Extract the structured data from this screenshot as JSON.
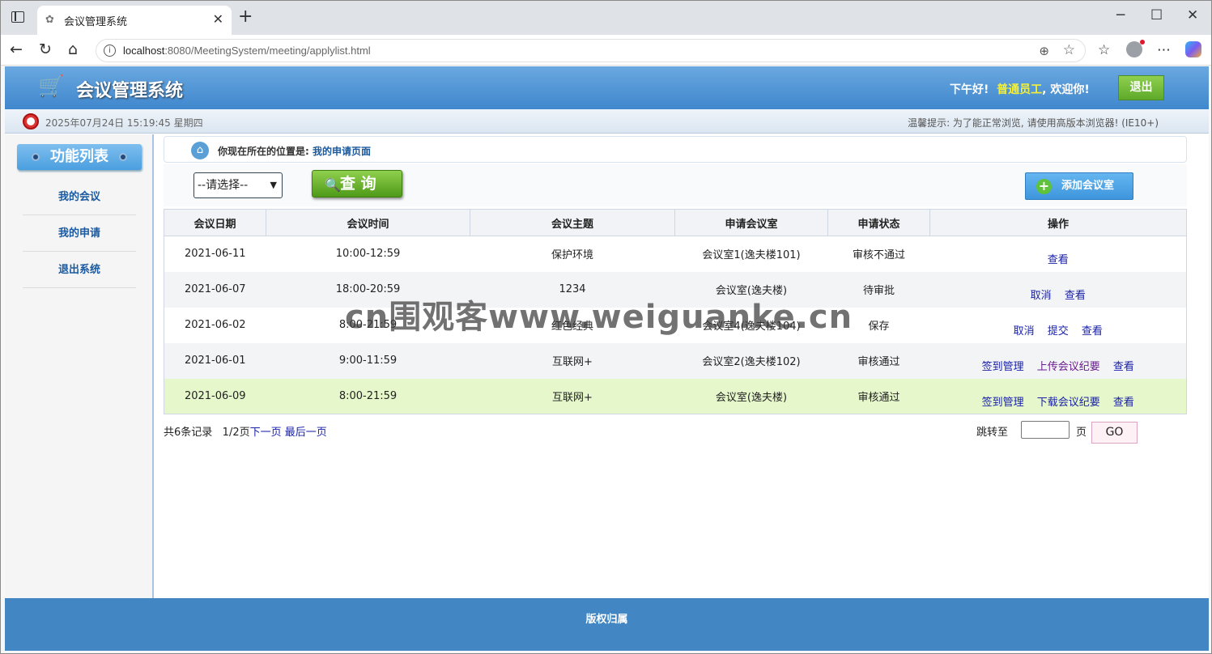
{
  "browser": {
    "tab_title": "会议管理系统",
    "url_host": "localhost",
    "url_rest": ":8080/MeetingSystem/meeting/applylist.html"
  },
  "header": {
    "title": "会议管理系统",
    "greeting": "下午好!",
    "role": "普通员工",
    "welcome": ", 欢迎你!",
    "logout_label": "退出"
  },
  "infobar": {
    "datetime": "2025年07月24日 15:19:45 星期四",
    "tip": "温馨提示: 为了能正常浏览, 请使用高版本浏览器! (IE10+)"
  },
  "sidebar": {
    "title": "功能列表",
    "items": [
      {
        "label": "我的会议"
      },
      {
        "label": "我的申请"
      },
      {
        "label": "退出系统"
      }
    ]
  },
  "breadcrumb": {
    "prefix": "你现在所在的位置是:",
    "current": "我的申请页面"
  },
  "toolbar": {
    "select_value": "--请选择--",
    "query_label": "查 询",
    "add_room_label": "添加会议室"
  },
  "table": {
    "headers": [
      "会议日期",
      "会议时间",
      "会议主题",
      "申请会议室",
      "申请状态",
      "操作"
    ],
    "rows": [
      {
        "date": "2021-06-11",
        "time": "10:00-12:59",
        "topic": "保护环境",
        "room": "会议室1(逸夫楼101)",
        "status": "审核不通过",
        "ops": [
          "查看"
        ]
      },
      {
        "date": "2021-06-07",
        "time": "18:00-20:59",
        "topic": "1234",
        "room": "会议室(逸夫楼)",
        "status": "待审批",
        "ops": [
          "取消",
          "查看"
        ]
      },
      {
        "date": "2021-06-02",
        "time": "8:00-21:59",
        "topic": "红色经典",
        "room": "会议室4(逸夫楼104)",
        "status": "保存",
        "ops": [
          "取消",
          "提交",
          "查看"
        ]
      },
      {
        "date": "2021-06-01",
        "time": "9:00-11:59",
        "topic": "互联网+",
        "room": "会议室2(逸夫楼102)",
        "status": "审核通过",
        "ops": [
          "签到管理",
          "上传会议纪要",
          "查看"
        ]
      },
      {
        "date": "2021-06-09",
        "time": "8:00-21:59",
        "topic": "互联网+",
        "room": "会议室(逸夫楼)",
        "status": "审核通过",
        "ops": [
          "签到管理",
          "下载会议纪要",
          "查看"
        ]
      }
    ]
  },
  "pager": {
    "summary": "共6条记录   1/2页",
    "next": "下一页",
    "last": "最后一页",
    "jump_label": "跳转至",
    "page_unit": "页",
    "go_label": "GO"
  },
  "footer": {
    "text": "版权归属"
  },
  "watermark": "cn围观客www.weiguanke.cn"
}
